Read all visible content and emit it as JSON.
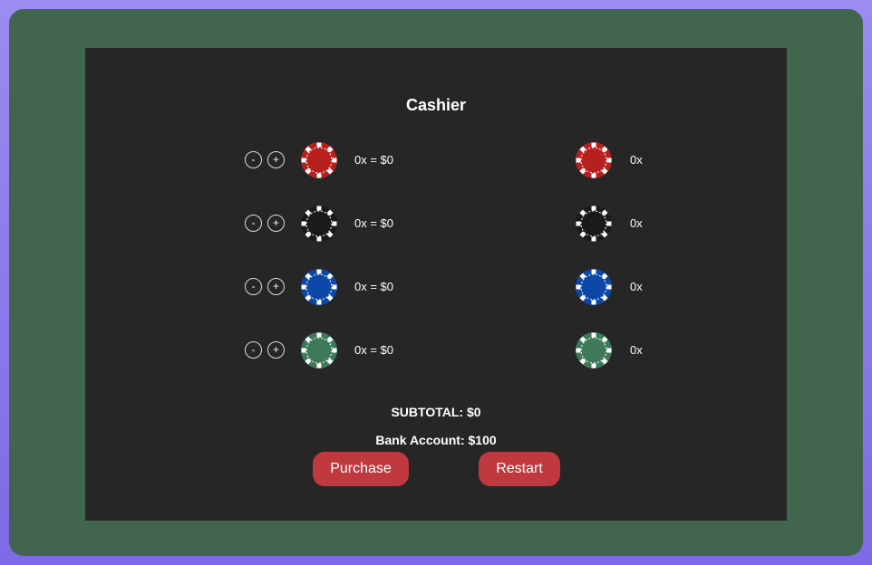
{
  "cashier": {
    "title": "Cashier",
    "minus_label": "-",
    "plus_label": "+",
    "purchase_rows": [
      {
        "color": "red",
        "color_hex": "#b8201e",
        "text": "0x = $0"
      },
      {
        "color": "black",
        "color_hex": "#1a1a1a",
        "text": "0x = $0"
      },
      {
        "color": "blue",
        "color_hex": "#0d47a8",
        "text": "0x = $0"
      },
      {
        "color": "green",
        "color_hex": "#3e7a5a",
        "text": "0x = $0"
      }
    ],
    "inventory_rows": [
      {
        "color": "red",
        "color_hex": "#b8201e",
        "text": "0x"
      },
      {
        "color": "black",
        "color_hex": "#1a1a1a",
        "text": "0x"
      },
      {
        "color": "blue",
        "color_hex": "#0d47a8",
        "text": "0x"
      },
      {
        "color": "green",
        "color_hex": "#3e7a5a",
        "text": "0x"
      }
    ],
    "subtotal": "SUBTOTAL: $0",
    "bank_account": "Bank Account: $100",
    "purchase_button": "Purchase",
    "restart_button": "Restart"
  },
  "colors": {
    "page_gradient": "#8a7ced",
    "frame": "#42654f",
    "panel": "#262626",
    "button": "#c0393e"
  }
}
